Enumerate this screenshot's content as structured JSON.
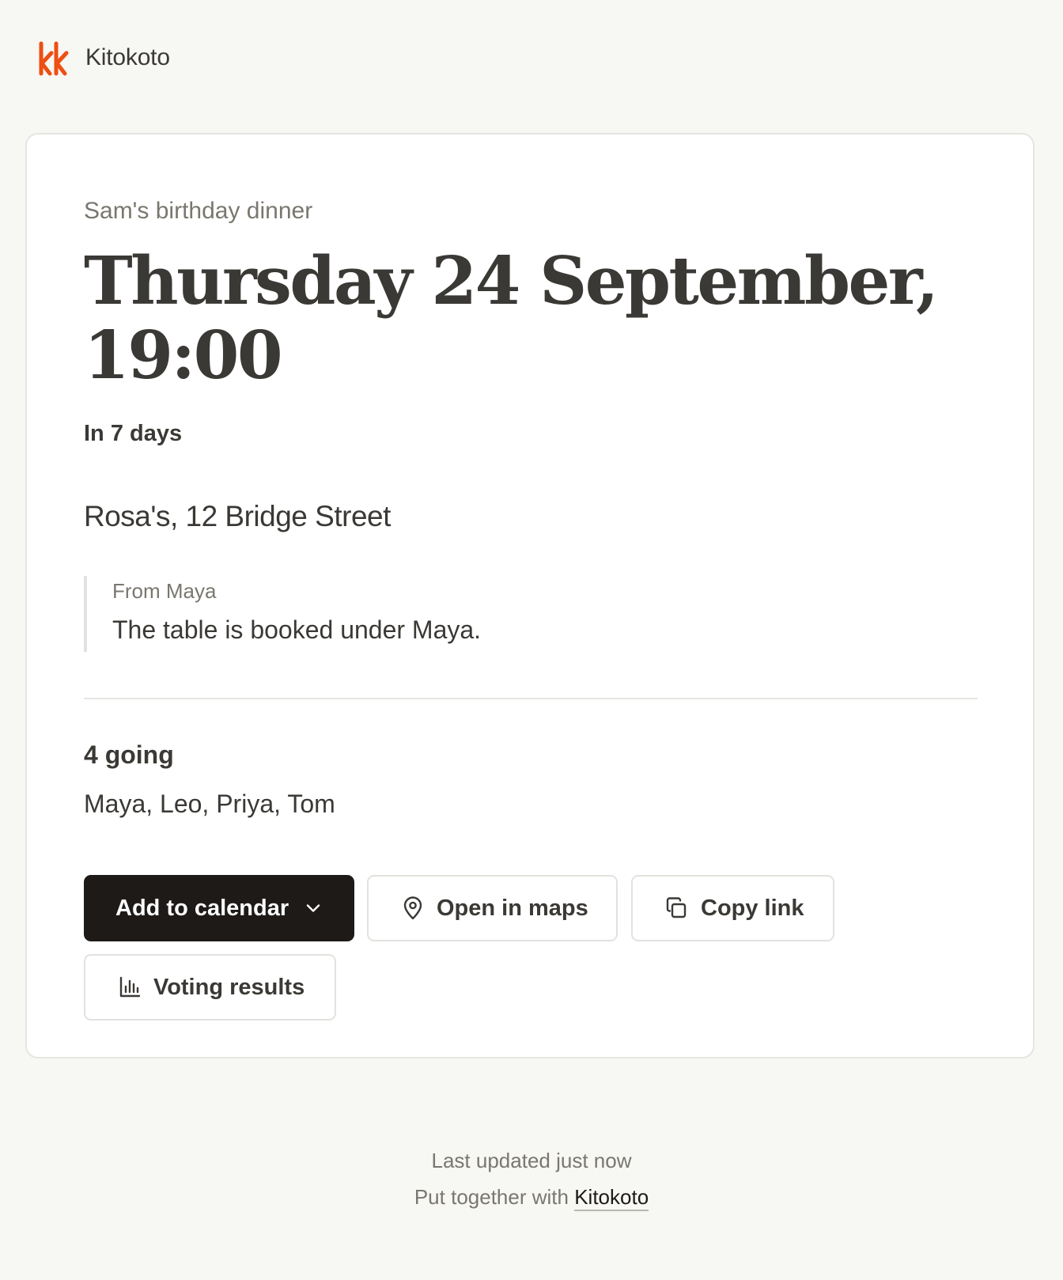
{
  "brand": {
    "name": "Kitokoto",
    "logo_icon": "kitokoto-logo-icon",
    "logo_color": "#ee4f13"
  },
  "event": {
    "name": "Sam's birthday dinner",
    "date_line1": "Thursday 24 September,",
    "date_line2": "19:00",
    "countdown": "In 7 days",
    "location": "Rosa's, 12 Bridge Street",
    "note": {
      "from": "From Maya",
      "text": "The table is booked under Maya."
    },
    "attendance": {
      "count_label": "4 going",
      "names": "Maya, Leo, Priya, Tom"
    }
  },
  "actions": {
    "add_to_calendar": {
      "label": "Add to calendar",
      "icon": "chevron-down-icon"
    },
    "open_in_maps": {
      "label": "Open in maps",
      "icon": "map-pin-icon"
    },
    "copy_link": {
      "label": "Copy link",
      "icon": "copy-icon"
    },
    "voting_results": {
      "label": "Voting results",
      "icon": "bar-chart-icon"
    }
  },
  "footer": {
    "updated": "Last updated just now",
    "credit_prefix": "Put together with",
    "credit_link": "Kitokoto"
  },
  "colors": {
    "background": "#f7f7f4",
    "card": "#ffffff",
    "primary_button": "#1d1a18",
    "text": "#3b3935",
    "muted_text": "#7a776f",
    "accent": "#ee4f13"
  }
}
